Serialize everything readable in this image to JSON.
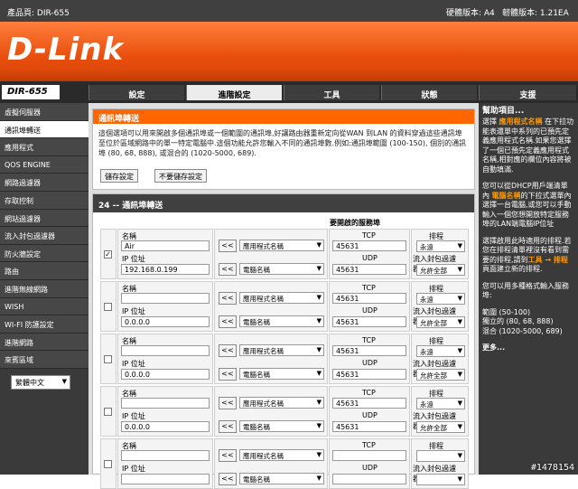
{
  "topbar": {
    "product": "產品頁: DIR-655",
    "hw_version": "硬體版本: A4",
    "fw_version": "韌體版本: 1.21EA"
  },
  "brand": {
    "logo": "D-Link"
  },
  "nav": {
    "model": "DIR-655",
    "tabs": [
      "設定",
      "進階設定",
      "工具",
      "狀態",
      "支援"
    ],
    "active_tab": 1
  },
  "sidebar": {
    "items": [
      "虛擬伺服器",
      "通訊埠轉送",
      "應用程式",
      "QOS ENGINE",
      "網路過濾器",
      "存取控制",
      "網站過濾器",
      "流入封包過濾器",
      "防火牆設定",
      "路由",
      "進階無線網路",
      "WISH",
      "WI-FI 防護設定",
      "進階網路",
      "來賓區域"
    ],
    "active_index": 1,
    "language": "繁體中文"
  },
  "panel1": {
    "title": "通訊埠轉送",
    "description": "這個選項可以用來開啟多個通訊埠或一個範圍的通訊埠,好讓路由器重新定向從WAN 到LAN 的資料穿過這些通訊埠至位於區域網路中的單一特定電腦中.這個功能允許您輸入不同的通訊埠數.例如:通訊埠範圍 (100-150), 個別的通訊埠 (80, 68, 888), 或混合的 (1020-5000, 689).",
    "save_label": "儲存設定",
    "nosave_label": "不要儲存設定"
  },
  "panel2": {
    "title": "24 -- 通訊埠轉送",
    "ports_header": "要開啟的服務埠",
    "name_label": "名稱",
    "ip_label": "IP 位址",
    "tcp_label": "TCP",
    "udp_label": "UDP",
    "schedule_label": "排程",
    "filter_label": "流入封包過濾器",
    "arrow_label": "<<",
    "rows": [
      {
        "checked": true,
        "name": "Air",
        "ip": "192.168.0.199",
        "app": "應用程式名稱",
        "computer": "電腦名稱",
        "tcp": "45631",
        "udp": "45631",
        "schedule": "永遠",
        "filter": "允許全部"
      },
      {
        "checked": false,
        "name": "",
        "ip": "0.0.0.0",
        "app": "應用程式名稱",
        "computer": "電腦名稱",
        "tcp": "45631",
        "udp": "45631",
        "schedule": "永遠",
        "filter": "允許全部"
      },
      {
        "checked": false,
        "name": "",
        "ip": "0.0.0.0",
        "app": "應用程式名稱",
        "computer": "電腦名稱",
        "tcp": "45631",
        "udp": "45631",
        "schedule": "永遠",
        "filter": "允許全部"
      },
      {
        "checked": false,
        "name": "",
        "ip": "0.0.0.0",
        "app": "應用程式名稱",
        "computer": "電腦名稱",
        "tcp": "45631",
        "udp": "45631",
        "schedule": "永遠",
        "filter": "允許全部"
      },
      {
        "checked": false,
        "name": "",
        "ip": "",
        "app": "應用程式名稱",
        "computer": "電腦名稱",
        "tcp": "",
        "udp": "",
        "schedule": "",
        "filter": ""
      }
    ]
  },
  "help": {
    "title": "幫助項目...",
    "p1_pre": "選擇 ",
    "p1_hl": "應用程式名稱",
    "p1_post": " 在下拉功能表還單中系列的已預先定義應用程式名稱.如果您選擇了一個已預先定義應用程式名稱,相對應的欄位內容將被自動填滿.",
    "p2_pre": "您可以從DHCP用戶端清單內 ",
    "p2_hl": "電腦名稱",
    "p2_post": "的下拉式選單內選擇一台電腦,或您可以手動輸入一個您想開放特定服務埠的LAN端電腦IP位址",
    "p3_pre": "選擇啟用此時適用的排程.若您在排程清單裡沒有看到需要的排程,請到",
    "p3_hl": "工具 → 排程",
    "p3_post": " 頁面建立新的排程.",
    "p4": "您可以用多種格式輸入服務埠:",
    "p5_a": "範圍 (50-100)",
    "p5_b": "獨立的 (80, 68, 888)",
    "p5_c": "混合 (1020-5000, 689)",
    "more": "更多..."
  },
  "watermark": "#1478154"
}
